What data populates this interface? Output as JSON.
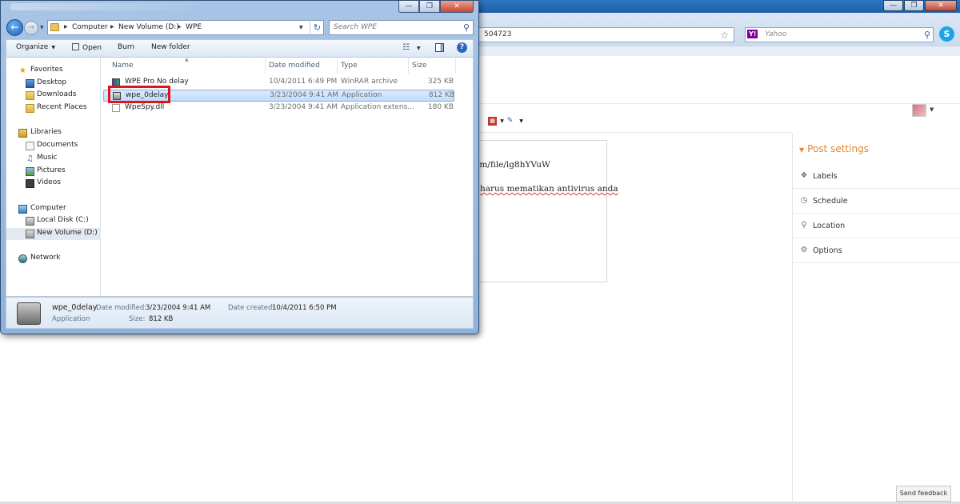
{
  "browser": {
    "address_fragment": "504723",
    "search_provider": "Yahoo",
    "skype_letter": "S"
  },
  "editor": {
    "line1": "om/file/lg8hYVuW",
    "line2": "harus mematikan antivirus anda"
  },
  "post_settings": {
    "title": "Post settings",
    "items": [
      "Labels",
      "Schedule",
      "Location",
      "Options"
    ]
  },
  "feedback_button": "Send feedback",
  "explorer": {
    "breadcrumb": [
      "Computer",
      "New Volume (D:)",
      "WPE"
    ],
    "search_placeholder": "Search WPE",
    "commands": {
      "organize": "Organize",
      "open": "Open",
      "burn": "Burn",
      "new_folder": "New folder"
    },
    "nav": {
      "favorites": "Favorites",
      "desktop": "Desktop",
      "downloads": "Downloads",
      "recent": "Recent Places",
      "libraries": "Libraries",
      "documents": "Documents",
      "music": "Music",
      "pictures": "Pictures",
      "videos": "Videos",
      "computer": "Computer",
      "local_disk": "Local Disk (C:)",
      "new_volume": "New Volume (D:)",
      "network": "Network"
    },
    "columns": [
      "Name",
      "Date modified",
      "Type",
      "Size"
    ],
    "files": [
      {
        "name": "WPE Pro No delay",
        "date": "10/4/2011 6:49 PM",
        "type": "WinRAR archive",
        "size": "325 KB"
      },
      {
        "name": "wpe_0delay",
        "date": "3/23/2004 9:41 AM",
        "type": "Application",
        "size": "812 KB"
      },
      {
        "name": "WpeSpy.dll",
        "date": "3/23/2004 9:41 AM",
        "type": "Application extens...",
        "size": "180 KB"
      }
    ],
    "details": {
      "name": "wpe_0delay",
      "type": "Application",
      "date_modified_label": "Date modified:",
      "date_modified": "3/23/2004 9:41 AM",
      "date_created_label": "Date created:",
      "date_created": "10/4/2011 6:50 PM",
      "size_label": "Size:",
      "size": "812 KB"
    }
  }
}
